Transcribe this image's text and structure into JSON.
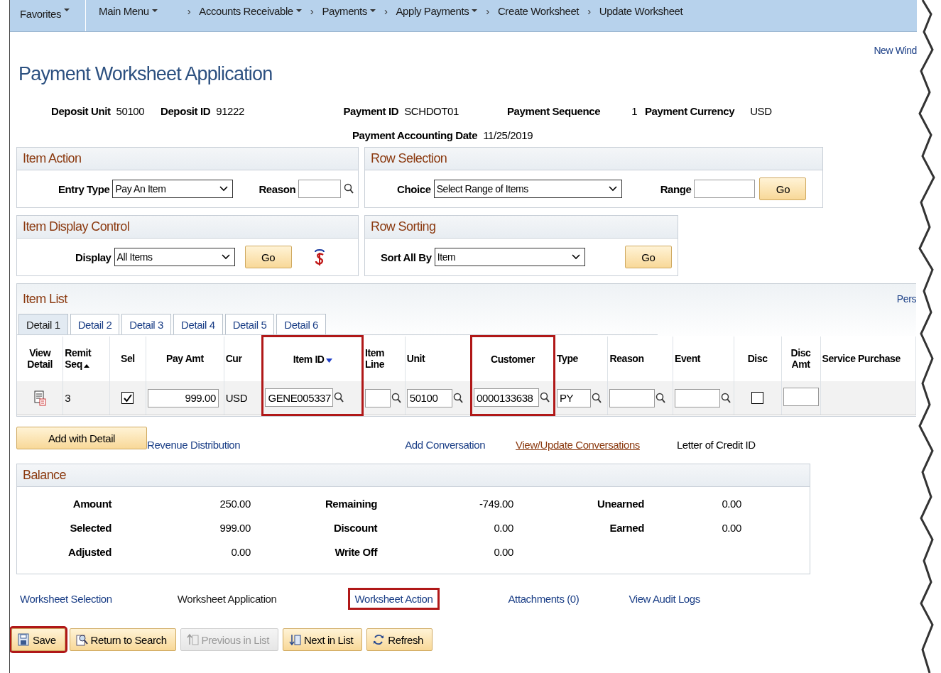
{
  "nav": [
    {
      "label": "Favorites",
      "dropdown": true
    },
    {
      "label": "Main Menu",
      "dropdown": true
    },
    {
      "label": "Accounts Receivable",
      "dropdown": true,
      "sep": "›"
    },
    {
      "label": "Payments",
      "dropdown": true,
      "sep": "›"
    },
    {
      "label": "Apply Payments",
      "dropdown": true,
      "sep": "›"
    },
    {
      "label": "Create Worksheet",
      "dropdown": false,
      "sep": "›"
    },
    {
      "label": "Update Worksheet",
      "dropdown": false,
      "sep": "›"
    }
  ],
  "new_window": "New Wind",
  "title": "Payment Worksheet Application",
  "header": [
    {
      "label": "Deposit Unit",
      "value": "50100"
    },
    {
      "label": "Deposit ID",
      "value": "91222"
    },
    {
      "label": "Payment ID",
      "value": "SCHDOT01"
    },
    {
      "label": "Payment Sequence",
      "value": "1"
    },
    {
      "label": "Payment Currency",
      "value": "USD"
    },
    {
      "label": "Payment Accounting Date",
      "value": "11/25/2019"
    }
  ],
  "panels": [
    {
      "title": "Item Action",
      "fields": [
        {
          "kind": "select",
          "label": "Entry Type",
          "value": "Pay An Item"
        },
        {
          "kind": "lookup",
          "label": "Reason"
        }
      ]
    },
    {
      "title": "Row Selection",
      "fields": [
        {
          "kind": "select",
          "label": "Choice",
          "value": "Select Range of Items"
        },
        {
          "kind": "input",
          "label": "Range"
        },
        {
          "kind": "button",
          "label": "Go"
        }
      ]
    },
    {
      "title": "Item Display Control",
      "fields": [
        {
          "kind": "select",
          "label": "Display",
          "value": "All Items"
        },
        {
          "kind": "button",
          "label": "Go"
        },
        {
          "kind": "icon"
        }
      ]
    },
    {
      "title": "Row Sorting",
      "fields": [
        {
          "kind": "select",
          "label": "Sort All By",
          "value": "Item"
        },
        {
          "kind": "button",
          "label": "Go"
        }
      ]
    }
  ],
  "item_list": {
    "title": "Item List",
    "personalize": "Pers",
    "tabs": [
      {
        "label": "Detail 1",
        "selected": true
      },
      {
        "label": "Detail 2",
        "selected": false
      },
      {
        "label": "Detail 3",
        "selected": false
      },
      {
        "label": "Detail 4",
        "selected": false
      },
      {
        "label": "Detail 5",
        "selected": false
      },
      {
        "label": "Detail 6",
        "selected": false
      }
    ],
    "columns": [
      {
        "label": "View Detail",
        "highlighted": false
      },
      {
        "label": "Remit Seq",
        "sort_ascending": true,
        "highlighted": false
      },
      {
        "label": "Sel",
        "highlighted": false
      },
      {
        "label": "Pay Amt",
        "highlighted": false
      },
      {
        "label": "Cur",
        "highlighted": false
      },
      {
        "label": "Item ID",
        "sort_descending": true,
        "highlighted": true
      },
      {
        "label": "Item Line",
        "highlighted": false
      },
      {
        "label": "Unit",
        "highlighted": false
      },
      {
        "label": "Customer",
        "highlighted": true
      },
      {
        "label": "Type",
        "highlighted": false
      },
      {
        "label": "Reason",
        "highlighted": false
      },
      {
        "label": "Event",
        "highlighted": false
      },
      {
        "label": "Disc",
        "highlighted": false
      },
      {
        "label": "Disc Amt",
        "highlighted": false
      },
      {
        "label": "Service Purchase",
        "highlighted": false
      }
    ],
    "rows": [
      [
        {
          "kind": "icon"
        },
        {
          "kind": "text",
          "value": "3"
        },
        {
          "kind": "checkbox",
          "checked": true
        },
        {
          "kind": "amount",
          "value": "999.00"
        },
        {
          "kind": "text",
          "value": "USD"
        },
        {
          "kind": "lookup",
          "value": "GENE005337"
        },
        {
          "kind": "lookup"
        },
        {
          "kind": "lookup",
          "value": "50100"
        },
        {
          "kind": "lookup",
          "value": "0000133638"
        },
        {
          "kind": "lookup",
          "value": "PY"
        },
        {
          "kind": "lookup"
        },
        {
          "kind": "lookup"
        },
        {
          "kind": "checkbox",
          "checked": false
        },
        {
          "kind": "input"
        }
      ]
    ]
  },
  "add_with_detail": "Add with Detail",
  "item_links": [
    {
      "label": "Revenue Distribution",
      "kind": "link"
    },
    {
      "label": "Add Conversation",
      "kind": "link"
    },
    {
      "label": "View/Update Conversations",
      "kind": "visited"
    },
    {
      "label": "Letter of Credit ID",
      "kind": "text"
    }
  ],
  "balance": {
    "title": "Balance",
    "columns": [
      [
        {
          "label": "Amount",
          "value": "250.00"
        },
        {
          "label": "Selected",
          "value": "999.00"
        },
        {
          "label": "Adjusted",
          "value": "0.00"
        }
      ],
      [
        {
          "label": "Remaining",
          "value": "-749.00"
        },
        {
          "label": "Discount",
          "value": "0.00"
        },
        {
          "label": "Write Off",
          "value": "0.00"
        }
      ],
      [
        {
          "label": "Unearned",
          "value": "0.00"
        },
        {
          "label": "Earned",
          "value": "0.00"
        }
      ]
    ]
  },
  "page_links": [
    {
      "label": "Worksheet Selection",
      "current": false,
      "highlighted": false
    },
    {
      "label": "Worksheet Application",
      "current": true,
      "highlighted": false
    },
    {
      "label": "Worksheet Action",
      "current": false,
      "highlighted": true
    },
    {
      "label": "Attachments (0)",
      "current": false,
      "highlighted": false
    },
    {
      "label": "View Audit Logs",
      "current": false,
      "highlighted": false
    }
  ],
  "toolbar": [
    {
      "label": "Save",
      "kind": "save",
      "disabled": false,
      "highlighted": true
    },
    {
      "label": "Return to Search",
      "kind": "search",
      "disabled": false,
      "highlighted": false
    },
    {
      "label": "Previous in List",
      "kind": "prev",
      "disabled": true,
      "highlighted": false
    },
    {
      "label": "Next in List",
      "kind": "next",
      "disabled": false,
      "highlighted": false
    },
    {
      "label": "Refresh",
      "kind": "refresh",
      "disabled": false,
      "highlighted": false
    }
  ]
}
